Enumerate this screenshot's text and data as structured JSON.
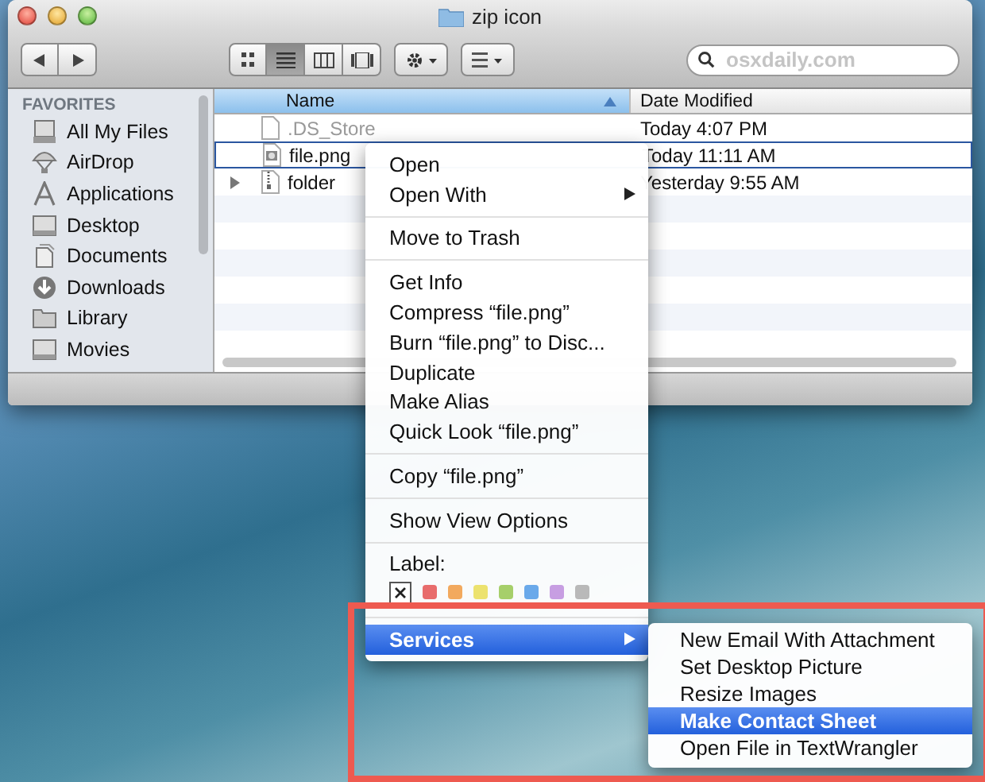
{
  "window": {
    "title": "zip icon"
  },
  "toolbar": {
    "views": [
      {
        "kind": "icons",
        "selected": false
      },
      {
        "kind": "list",
        "selected": true
      },
      {
        "kind": "columns",
        "selected": false
      },
      {
        "kind": "coverflow",
        "selected": false
      }
    ],
    "search": {
      "placeholder": "osxdaily.com"
    }
  },
  "sidebar": {
    "heading": "FAVORITES",
    "items": [
      {
        "label": "All My Files",
        "kind": "files"
      },
      {
        "label": "AirDrop",
        "kind": "airdrop"
      },
      {
        "label": "Applications",
        "kind": "apps"
      },
      {
        "label": "Desktop",
        "kind": "desktop"
      },
      {
        "label": "Documents",
        "kind": "documents"
      },
      {
        "label": "Downloads",
        "kind": "downloads"
      },
      {
        "label": "Library",
        "kind": "folder"
      },
      {
        "label": "Movies",
        "kind": "desktop"
      }
    ]
  },
  "table": {
    "columns": [
      {
        "label": "Name",
        "sorted": true
      },
      {
        "label": "Date Modified",
        "sorted": false
      }
    ],
    "rows": [
      {
        "name": ".DS_Store",
        "date": "Today 4:07 PM",
        "kind": "file",
        "hidden": true,
        "selected": false,
        "expandable": false
      },
      {
        "name": "file.png",
        "date": "Today 11:11 AM",
        "kind": "image",
        "hidden": false,
        "selected": true,
        "expandable": false
      },
      {
        "name": "folder",
        "date": "Yesterday 9:55 AM",
        "kind": "zip",
        "hidden": false,
        "selected": false,
        "expandable": true
      }
    ]
  },
  "context_menu": {
    "groups": [
      [
        {
          "label": "Open",
          "submenu": false,
          "selected": false
        },
        {
          "label": "Open With",
          "submenu": true,
          "selected": false
        }
      ],
      [
        {
          "label": "Move to Trash",
          "submenu": false,
          "selected": false
        }
      ],
      [
        {
          "label": "Get Info",
          "submenu": false,
          "selected": false
        },
        {
          "label": "Compress “file.png”",
          "submenu": false,
          "selected": false
        },
        {
          "label": "Burn “file.png” to Disc...",
          "submenu": false,
          "selected": false
        },
        {
          "label": "Duplicate",
          "submenu": false,
          "selected": false
        },
        {
          "label": "Make Alias",
          "submenu": false,
          "selected": false
        },
        {
          "label": "Quick Look “file.png”",
          "submenu": false,
          "selected": false
        }
      ],
      [
        {
          "label": "Copy “file.png”",
          "submenu": false,
          "selected": false
        }
      ],
      [
        {
          "label": "Show View Options",
          "submenu": false,
          "selected": false
        }
      ]
    ],
    "label_heading": "Label:",
    "labels": [
      {
        "kind": "none",
        "selected": true
      },
      {
        "kind": "color",
        "color": "#e86c6c",
        "selected": false
      },
      {
        "kind": "color",
        "color": "#f2a95e",
        "selected": false
      },
      {
        "kind": "color",
        "color": "#ece26e",
        "selected": false
      },
      {
        "kind": "color",
        "color": "#a6cf6a",
        "selected": false
      },
      {
        "kind": "color",
        "color": "#6aa9ea",
        "selected": false
      },
      {
        "kind": "color",
        "color": "#c79ee2",
        "selected": false
      },
      {
        "kind": "color",
        "color": "#b9b9b9",
        "selected": false
      }
    ],
    "services": {
      "label": "Services",
      "submenu": true,
      "selected": true
    }
  },
  "services_menu": {
    "items": [
      {
        "label": "New Email With Attachment",
        "selected": false
      },
      {
        "label": "Set Desktop Picture",
        "selected": false
      },
      {
        "label": "Resize Images",
        "selected": false
      },
      {
        "label": "Make Contact Sheet",
        "selected": true
      },
      {
        "label": "Open File in TextWrangler",
        "selected": false
      }
    ]
  }
}
